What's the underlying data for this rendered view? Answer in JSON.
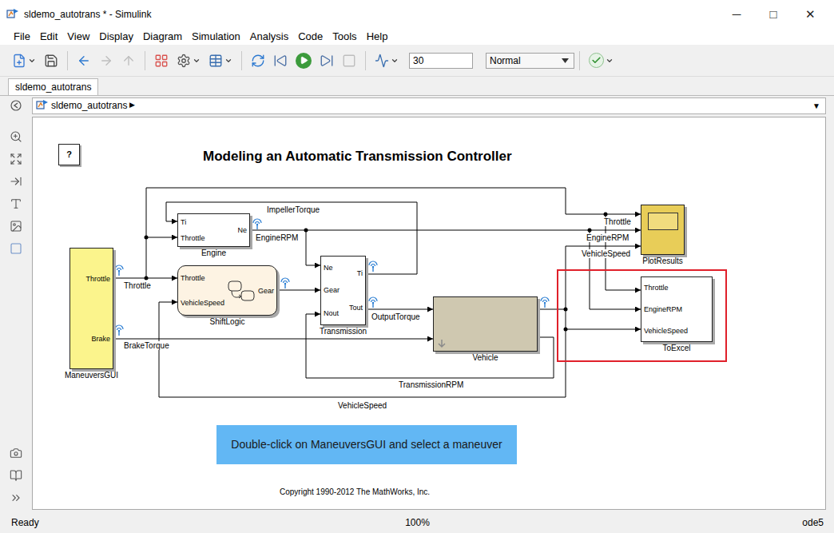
{
  "window": {
    "title": "sldemo_autotrans * - Simulink",
    "controls": [
      "─",
      "□",
      "✕"
    ]
  },
  "menu": [
    "File",
    "Edit",
    "View",
    "Display",
    "Diagram",
    "Simulation",
    "Analysis",
    "Code",
    "Tools",
    "Help"
  ],
  "toolbar": {
    "groups": [
      [
        {
          "kind": "new",
          "disabled": false,
          "dropdown": true
        },
        {
          "kind": "save",
          "disabled": false,
          "dropdown": false
        }
      ],
      [
        {
          "kind": "back",
          "disabled": false,
          "dropdown": false
        },
        {
          "kind": "forward",
          "disabled": true,
          "dropdown": false
        },
        {
          "kind": "up",
          "disabled": true,
          "dropdown": false
        }
      ],
      [
        {
          "kind": "library",
          "disabled": false,
          "dropdown": false
        },
        {
          "kind": "settings",
          "disabled": false,
          "dropdown": true
        },
        {
          "kind": "explorer",
          "disabled": false,
          "dropdown": true
        }
      ],
      [
        {
          "kind": "update",
          "disabled": false,
          "dropdown": false
        },
        {
          "kind": "stepback",
          "disabled": false,
          "dropdown": false
        },
        {
          "kind": "run",
          "disabled": false,
          "dropdown": false
        },
        {
          "kind": "stepforward",
          "disabled": false,
          "dropdown": false
        },
        {
          "kind": "stop",
          "disabled": true,
          "dropdown": false
        }
      ],
      [
        {
          "kind": "scope",
          "disabled": false,
          "dropdown": true
        },
        {
          "kind": "field",
          "disabled": false,
          "dropdown": false,
          "value": "30"
        },
        {
          "kind": "select",
          "disabled": false,
          "dropdown": true,
          "value": "Normal"
        }
      ],
      [
        {
          "kind": "check",
          "disabled": false,
          "dropdown": true
        }
      ]
    ]
  },
  "tabs": [
    {
      "label": "sldemo_autotrans",
      "selected": true
    }
  ],
  "breadcrumb": {
    "path": [
      "sldemo_autotrans"
    ],
    "separator": "▶",
    "menu": "▼"
  },
  "diagram": {
    "title": "Modeling an Automatic Transmission Controller",
    "help": "?",
    "blocks": [
      {
        "name": "ManeuversGUI",
        "kind": "gui",
        "inputs": [],
        "outputs": [
          "Throttle",
          "Brake"
        ],
        "color": "#fbf48c",
        "highlighted": false
      },
      {
        "name": "Engine",
        "kind": "subsystem",
        "inputs": [
          "Ti",
          "Throttle"
        ],
        "outputs": [
          "Ne"
        ],
        "color": "#ffffff",
        "highlighted": false
      },
      {
        "name": "ShiftLogic",
        "kind": "chart",
        "inputs": [
          "Throttle",
          "VehicleSpeed"
        ],
        "outputs": [
          "Gear"
        ],
        "color": "#fdf3e3",
        "highlighted": false
      },
      {
        "name": "Transmission",
        "kind": "subsystem",
        "inputs": [
          "Ne",
          "Gear",
          "Nout"
        ],
        "outputs": [
          "Ti",
          "Tout"
        ],
        "color": "#ffffff",
        "highlighted": false
      },
      {
        "name": "Vehicle",
        "kind": "image",
        "inputs": [],
        "outputs": [],
        "color": "#d9d4c2",
        "highlighted": false
      },
      {
        "name": "PlotResults",
        "kind": "scope",
        "inputs": [],
        "outputs": [],
        "color": "#e8cd58",
        "highlighted": false
      },
      {
        "name": "ToExcel",
        "kind": "subsystem",
        "inputs": [
          "Throttle",
          "EngineRPM",
          "VehicleSpeed"
        ],
        "outputs": [],
        "color": "#ffffff",
        "highlighted": true
      }
    ],
    "signal_labels": [
      "ImpellerTorque",
      "EngineRPM",
      "Throttle",
      "BrakeTorque",
      "OutputTorque",
      "TransmissionRPM",
      "VehicleSpeed",
      "Throttle",
      "EngineRPM",
      "VehicleSpeed"
    ],
    "annotation": "Double-click on ManeuversGUI and select a maneuver",
    "copyright": "Copyright 1990-2012 The MathWorks, Inc."
  },
  "status_bar": {
    "state": "Ready",
    "zoom": "100%",
    "solver": "ode5"
  }
}
